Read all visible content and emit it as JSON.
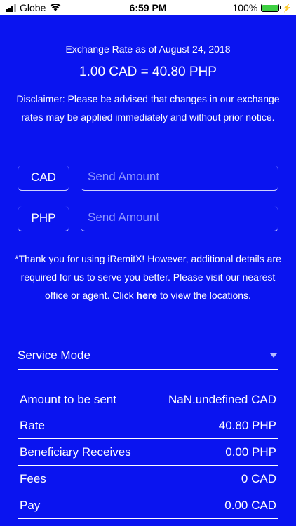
{
  "status_bar": {
    "carrier": "Globe",
    "time": "6:59 PM",
    "battery": "100%"
  },
  "rate": {
    "date_line": "Exchange Rate as of August 24, 2018",
    "main_line": "1.00 CAD = 40.80 PHP",
    "disclaimer": "Disclaimer: Please be advised that changes in our exchange rates may be applied immediately and without prior notice."
  },
  "send": {
    "currency": "CAD",
    "placeholder": "Send Amount"
  },
  "receive": {
    "currency": "PHP",
    "placeholder": "Send Amount"
  },
  "notice": {
    "before": "*Thank you for using iRemitX! However, additional details are required for us to serve you better. Please visit our nearest office or agent. Click ",
    "link": "here",
    "after": " to view the locations."
  },
  "service_mode": {
    "label": "Service Mode"
  },
  "summary": [
    {
      "label": "Amount to be sent",
      "value": "NaN.undefined CAD"
    },
    {
      "label": "Rate",
      "value": "40.80 PHP"
    },
    {
      "label": "Beneficiary Receives",
      "value": "0.00 PHP"
    },
    {
      "label": "Fees",
      "value": "0 CAD"
    },
    {
      "label": "Pay",
      "value": "0.00 CAD"
    }
  ],
  "colors": {
    "background": "#0a14f0",
    "text": "#ffffff",
    "battery": "#3ed043"
  },
  "battery_level": 1.0
}
